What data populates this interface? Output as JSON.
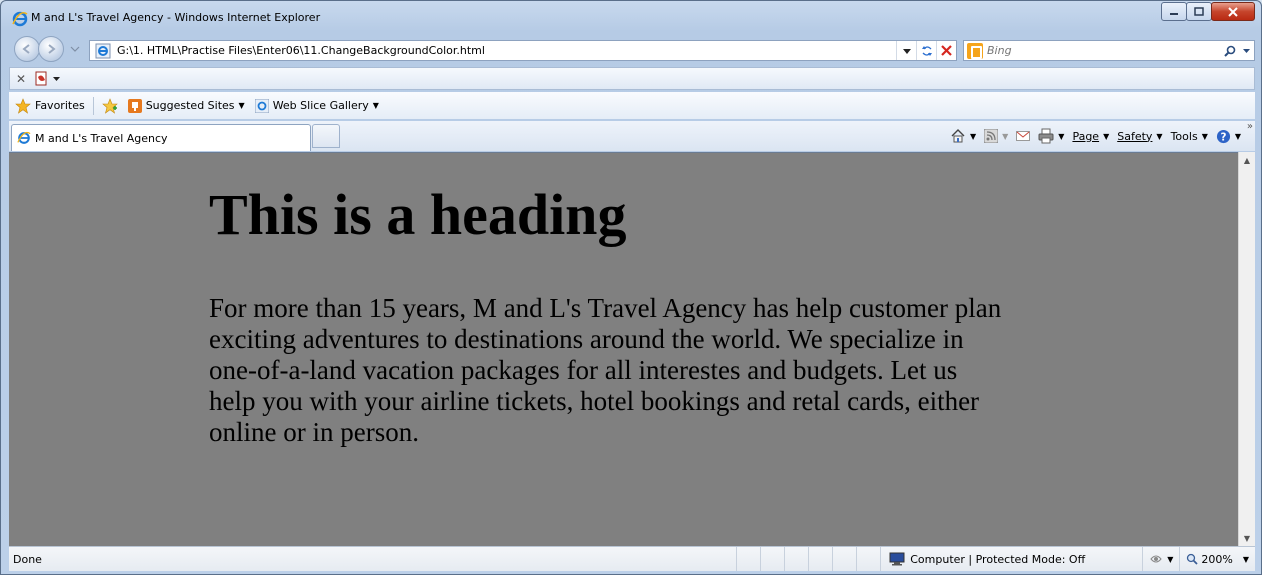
{
  "window": {
    "title": "M and L's Travel Agency - Windows Internet Explorer"
  },
  "address": {
    "url": "G:\\1. HTML\\Practise Files\\Enter06\\11.ChangeBackgroundColor.html"
  },
  "search": {
    "placeholder": "Bing"
  },
  "favorites_bar": {
    "favorites_label": "Favorites",
    "items": [
      {
        "label": "Suggested Sites"
      },
      {
        "label": "Web Slice Gallery"
      }
    ]
  },
  "tabs": [
    {
      "label": "M and L's Travel Agency",
      "active": true
    }
  ],
  "command_bar": {
    "page_label": "Page",
    "safety_label": "Safety",
    "tools_label": "Tools"
  },
  "page": {
    "heading": "This is a heading",
    "paragraph": "For more than 15 years, M and L's Travel Agency has help customer plan exciting adventures to destinations around the world. We specialize in one-of-a-land vacation packages for all interestes and budgets. Let us help you with your airline tickets, hotel bookings and retal cards, either online or in person.",
    "background_color": "#808080"
  },
  "status_bar": {
    "status_text": "Done",
    "zone_text": "Computer | Protected Mode: Off",
    "zoom": "200%"
  }
}
